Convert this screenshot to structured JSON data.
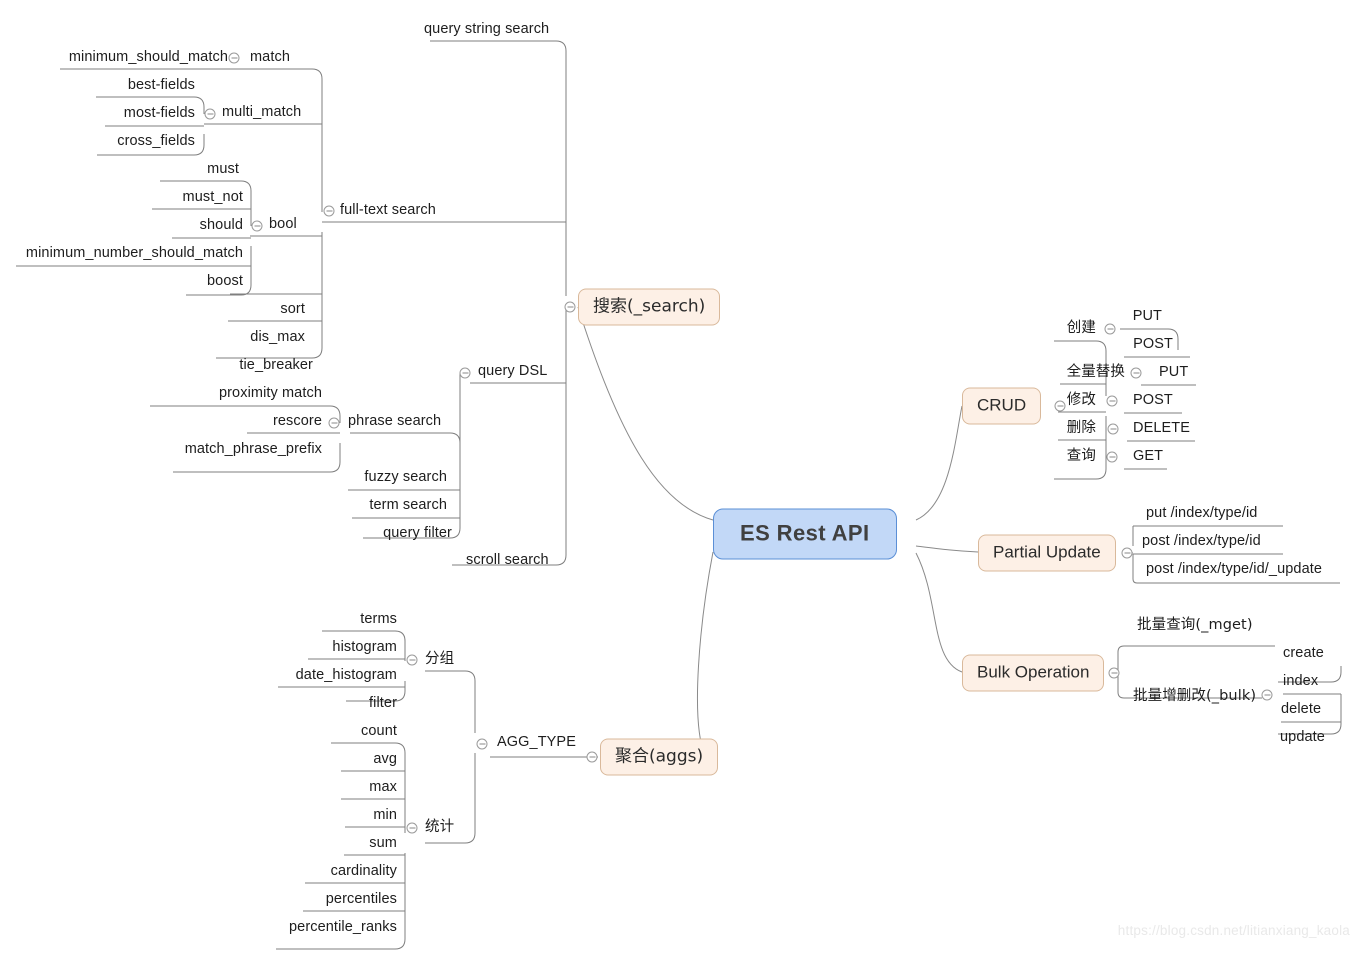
{
  "diagram": {
    "title": "ES Rest API",
    "type": "mind-map",
    "watermark": "https://blog.csdn.net/litianxiang_kaola",
    "colors": {
      "root_fill": "#c2d8f7",
      "root_border": "#5b8fd6",
      "branch_fill": "#fdf0e6",
      "branch_border": "#d9b99b",
      "line": "#7a7a7a",
      "text": "#1d1d1d",
      "watermark": "#e9e9e9"
    }
  },
  "root": {
    "label": "ES Rest API"
  },
  "branches": {
    "search": {
      "label": "搜索(_search)"
    },
    "crud": {
      "label": "CRUD"
    },
    "partial_update": {
      "label": "Partial Update"
    },
    "bulk_operation": {
      "label": "Bulk Operation"
    },
    "aggs": {
      "label": "聚合(aggs)"
    }
  },
  "search_children": {
    "query_string_search": {
      "label": "query string search"
    },
    "full_text_search": {
      "label": "full-text search"
    },
    "query_dsl": {
      "label": "query DSL"
    },
    "scroll_search": {
      "label": "scroll search"
    }
  },
  "full_text_search_children": {
    "match": {
      "label": "match"
    },
    "multi_match": {
      "label": "multi_match"
    },
    "bool": {
      "label": "bool"
    },
    "sort": {
      "label": "sort"
    },
    "dis_max": {
      "label": "dis_max"
    },
    "tie_breaker": {
      "label": "tie_breaker"
    }
  },
  "match_children": [
    {
      "label": "minimum_should_match"
    }
  ],
  "multi_match_children": [
    {
      "label": "best-fields"
    },
    {
      "label": "most-fields"
    },
    {
      "label": "cross_fields"
    }
  ],
  "bool_children": [
    {
      "label": "must"
    },
    {
      "label": "must_not"
    },
    {
      "label": "should"
    },
    {
      "label": "minimum_number_should_match"
    },
    {
      "label": "boost"
    }
  ],
  "query_dsl_children": {
    "phrase_search": {
      "label": "phrase search"
    },
    "fuzzy_search": {
      "label": "fuzzy search"
    },
    "term_search": {
      "label": "term search"
    },
    "query_filter": {
      "label": "query filter"
    }
  },
  "phrase_search_children": [
    {
      "label": "proximity match"
    },
    {
      "label": "rescore"
    },
    {
      "label": "match_phrase_prefix"
    }
  ],
  "crud_children": [
    {
      "label": "创建",
      "methods": [
        "PUT",
        "POST"
      ]
    },
    {
      "label": "全量替换",
      "methods": [
        "PUT"
      ]
    },
    {
      "label": "修改",
      "methods": [
        "POST"
      ]
    },
    {
      "label": "删除",
      "methods": [
        "DELETE"
      ]
    },
    {
      "label": "查询",
      "methods": [
        "GET"
      ]
    }
  ],
  "crud_leaves": {
    "create_put": "PUT",
    "create_post": "POST",
    "replace_put": "PUT",
    "modify_post": "POST",
    "delete_delete": "DELETE",
    "query_get": "GET"
  },
  "partial_update_children": [
    {
      "label": "put /index/type/id"
    },
    {
      "label": "post /index/type/id"
    },
    {
      "label": "post /index/type/id/_update"
    }
  ],
  "bulk_children": {
    "mget": {
      "label": "批量查询(_mget)"
    },
    "bulk": {
      "label": "批量增删改(_bulk)"
    }
  },
  "bulk_actions": [
    {
      "label": "create"
    },
    {
      "label": "index"
    },
    {
      "label": "delete"
    },
    {
      "label": "update"
    }
  ],
  "aggs_children": {
    "agg_type": {
      "label": "AGG_TYPE"
    },
    "group": {
      "label": "分组"
    },
    "stats": {
      "label": "统计"
    }
  },
  "group_children": [
    {
      "label": "terms"
    },
    {
      "label": "histogram"
    },
    {
      "label": "date_histogram"
    },
    {
      "label": "filter"
    }
  ],
  "stats_children": [
    {
      "label": "count"
    },
    {
      "label": "avg"
    },
    {
      "label": "max"
    },
    {
      "label": "min"
    },
    {
      "label": "sum"
    },
    {
      "label": "cardinality"
    },
    {
      "label": "percentiles"
    },
    {
      "label": "percentile_ranks"
    }
  ]
}
